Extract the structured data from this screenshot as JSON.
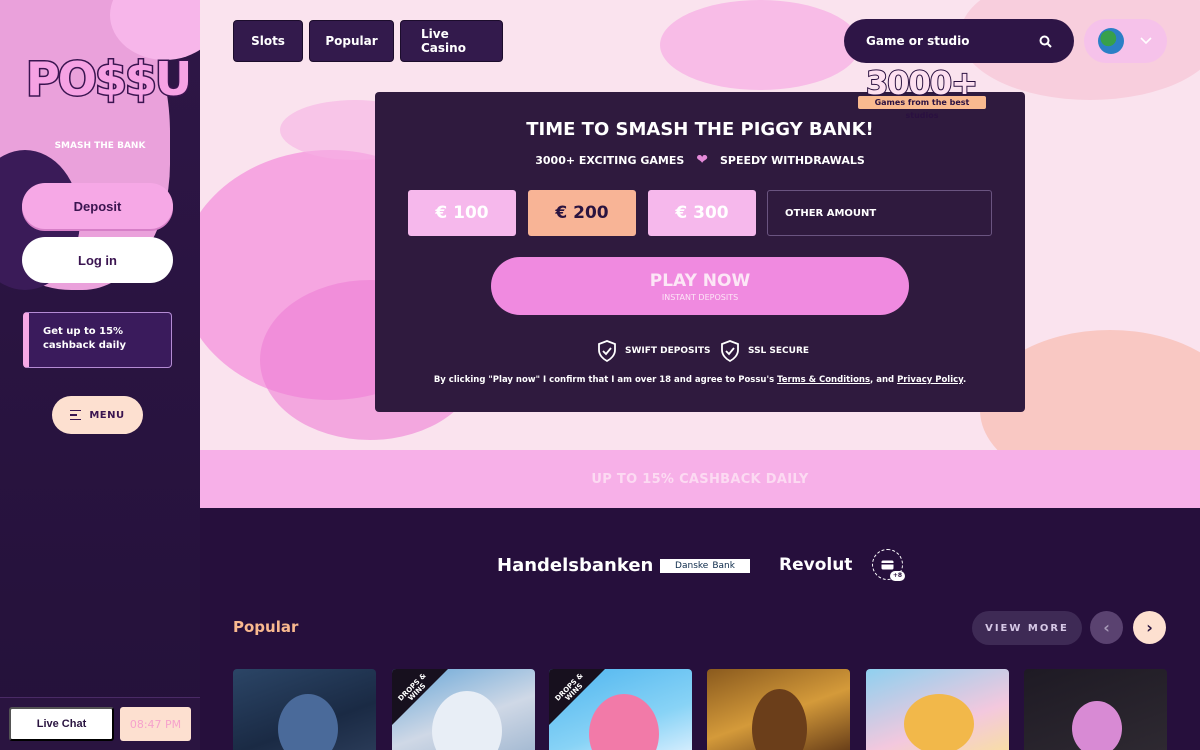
{
  "sidebar": {
    "logo_text": "PO$$U",
    "tagline": "SMASH THE BANK",
    "deposit_label": "Deposit",
    "login_label": "Log in",
    "cashback_card": {
      "line1": "Get up to 15%",
      "line2": "cashback daily"
    },
    "menu_label": "MENU",
    "live_chat_label": "Live Chat",
    "time": "08:47 PM"
  },
  "nav": {
    "tabs": [
      {
        "label": "Slots"
      },
      {
        "label": "Popular"
      },
      {
        "label": "Live Casino"
      }
    ],
    "search_placeholder": "Game or studio",
    "language_icon": "globe-icon"
  },
  "hero": {
    "badge_number": "3000+",
    "badge_sub": "Games from the best studios",
    "title": "TIME TO SMASH THE PIGGY BANK!",
    "feature1": "3000+ EXCITING GAMES",
    "feature2": "SPEEDY WITHDRAWALS",
    "amounts": [
      "€ 100",
      "€ 200",
      "€ 300"
    ],
    "other_amount_label": "OTHER AMOUNT",
    "play_label": "PLAY NOW",
    "play_sub": "INSTANT DEPOSITS",
    "trust1": "SWIFT DEPOSITS",
    "trust2": "SSL SECURE",
    "disclaimer_pre": "By clicking \"Play now\" I confirm that I am over 18 and agree to Possu's",
    "terms_link": "Terms & Conditions",
    "disclaimer_mid": ", and",
    "privacy_link": "Privacy Policy",
    "disclaimer_end": "."
  },
  "band": {
    "text": "UP TO 15% CASHBACK DAILY"
  },
  "payments": {
    "handelsbanken": "Handelsbanken",
    "danske_1": "Danske",
    "danske_2": "Bank",
    "revolut": "Revolut",
    "more_count": "+8"
  },
  "popular": {
    "title": "Popular",
    "view_more": "VIEW MORE",
    "corner_badge": "DROPS & WINS"
  },
  "colors": {
    "sidebar_bg": "#2e1646",
    "accent_pink": "#f6a8e6",
    "peach": "#f8b496",
    "card_bg": "#2f1a3e",
    "band_bg": "#f7b0e8"
  }
}
